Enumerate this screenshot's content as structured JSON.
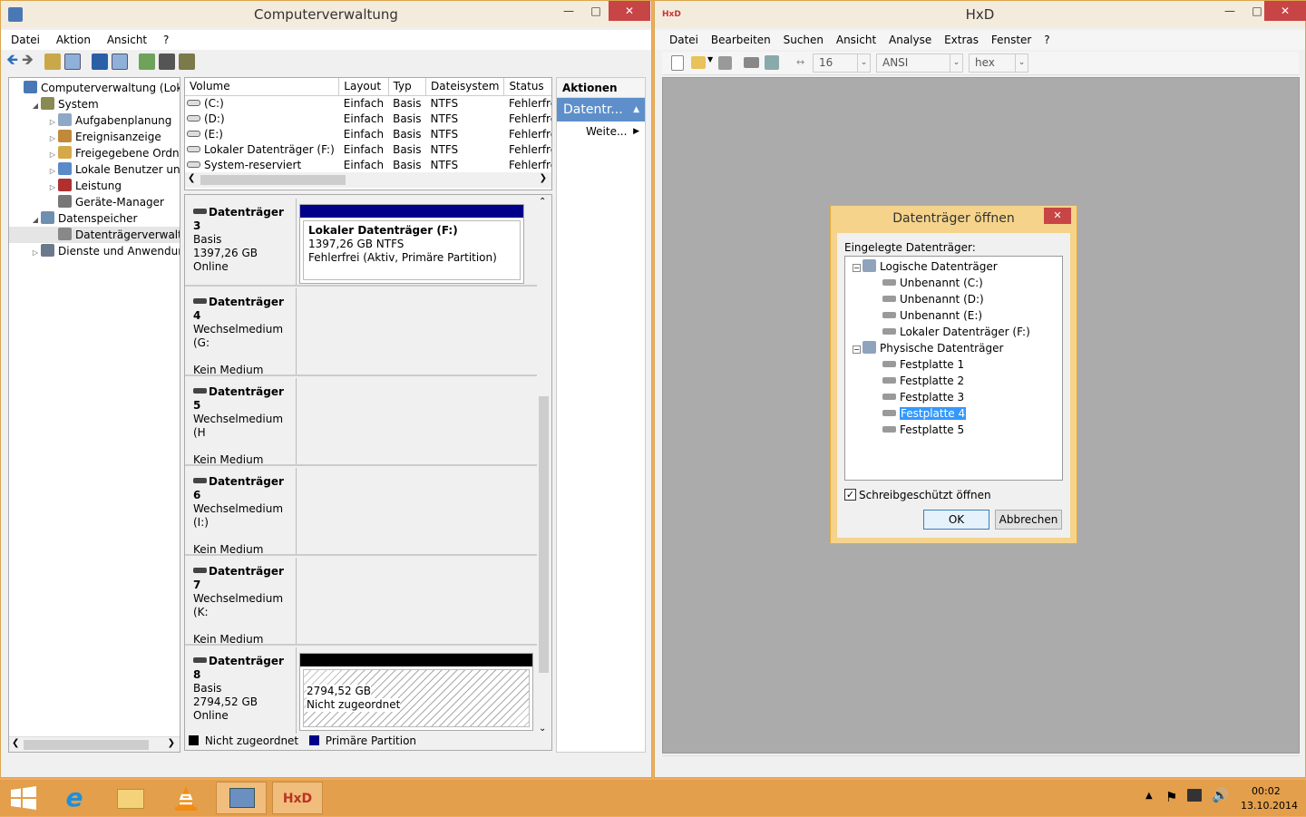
{
  "cm": {
    "title": "Computerverwaltung",
    "menu": [
      "Datei",
      "Aktion",
      "Ansicht",
      "?"
    ],
    "tree": [
      {
        "label": "Computerverwaltung (Lokal)",
        "level": 0,
        "exp": ""
      },
      {
        "label": "System",
        "level": 1,
        "exp": "◢"
      },
      {
        "label": "Aufgabenplanung",
        "level": 2,
        "exp": "▷"
      },
      {
        "label": "Ereignisanzeige",
        "level": 2,
        "exp": "▷"
      },
      {
        "label": "Freigegebene Ordner",
        "level": 2,
        "exp": "▷"
      },
      {
        "label": "Lokale Benutzer und Gr",
        "level": 2,
        "exp": "▷"
      },
      {
        "label": "Leistung",
        "level": 2,
        "exp": "▷"
      },
      {
        "label": "Geräte-Manager",
        "level": 2,
        "exp": ""
      },
      {
        "label": "Datenspeicher",
        "level": 1,
        "exp": "◢"
      },
      {
        "label": "Datenträgerverwaltung",
        "level": 2,
        "exp": ""
      },
      {
        "label": "Dienste und Anwendungen",
        "level": 1,
        "exp": "▷"
      }
    ],
    "columns": [
      "Volume",
      "Layout",
      "Typ",
      "Dateisystem",
      "Status"
    ],
    "volumes": [
      [
        "(C:)",
        "Einfach",
        "Basis",
        "NTFS",
        "Fehlerfrei (Startp"
      ],
      [
        "(D:)",
        "Einfach",
        "Basis",
        "NTFS",
        "Fehlerfrei (Primä"
      ],
      [
        "(E:)",
        "Einfach",
        "Basis",
        "NTFS",
        "Fehlerfrei (Primä"
      ],
      [
        "Lokaler Datenträger (F:)",
        "Einfach",
        "Basis",
        "NTFS",
        "Fehlerfrei (Aktiv,"
      ],
      [
        "System-reserviert",
        "Einfach",
        "Basis",
        "NTFS",
        "Fehlerfrei (Syster"
      ]
    ],
    "disks": [
      {
        "name": "Datenträger 3",
        "line1": "Basis",
        "line2": "1397,26 GB",
        "line3": "Online",
        "part_title": "Lokaler Datenträger  (F:)",
        "part_line1": "1397,26 GB NTFS",
        "part_line2": "Fehlerfrei (Aktiv, Primäre Partition)"
      },
      {
        "name": "Datenträger 4",
        "line1": "Wechselmedium (G:",
        "line2": "",
        "line3": "Kein Medium"
      },
      {
        "name": "Datenträger 5",
        "line1": "Wechselmedium (H",
        "line2": "",
        "line3": "Kein Medium"
      },
      {
        "name": "Datenträger 6",
        "line1": "Wechselmedium (I:)",
        "line2": "",
        "line3": "Kein Medium"
      },
      {
        "name": "Datenträger 7",
        "line1": "Wechselmedium (K:",
        "line2": "",
        "line3": "Kein Medium"
      },
      {
        "name": "Datenträger 8",
        "line1": "Basis",
        "line2": "2794,52 GB",
        "line3": "Online",
        "part_line1": "2794,52 GB",
        "part_line2": "Nicht zugeordnet"
      }
    ],
    "legend": {
      "unallocated": "Nicht zugeordnet",
      "primary": "Primäre Partition"
    },
    "actions": {
      "header": "Aktionen",
      "section": "Datentr...",
      "more": "Weite..."
    }
  },
  "hxd": {
    "title": "HxD",
    "menu": [
      "Datei",
      "Bearbeiten",
      "Suchen",
      "Ansicht",
      "Analyse",
      "Extras",
      "Fenster",
      "?"
    ],
    "bytes_per_row": "16",
    "charset": "ANSI",
    "offset_base": "hex"
  },
  "dialog": {
    "title": "Datenträger öffnen",
    "label": "Eingelegte Datenträger:",
    "logical_header": "Logische Datenträger",
    "logical": [
      "Unbenannt (C:)",
      "Unbenannt (D:)",
      "Unbenannt (E:)",
      "Lokaler Datenträger (F:)"
    ],
    "physical_header": "Physische Datenträger",
    "physical": [
      "Festplatte 1",
      "Festplatte 2",
      "Festplatte 3",
      "Festplatte 4",
      "Festplatte 5"
    ],
    "selected": "Festplatte 4",
    "readonly_label": "Schreibgeschützt öffnen",
    "readonly": true,
    "ok": "OK",
    "cancel": "Abbrechen"
  },
  "taskbar": {
    "time": "00:02",
    "date": "13.10.2014"
  },
  "colors": {
    "primary_partition": "#00008b",
    "unallocated": "#000000",
    "selection": "#3399ff",
    "taskbar": "#e39f4c"
  }
}
